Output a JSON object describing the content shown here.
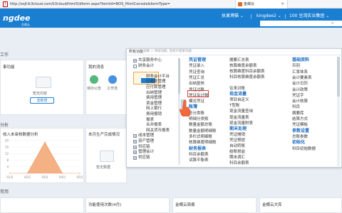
{
  "browser": {
    "url": "http://zsjf.ik3cloud.com/k3cloud/html5/dform.aspx?formId=BOS_HtmlConsole&formType=",
    "tab_title": "金蝶云"
  },
  "header": {
    "logo": "ngdee",
    "logo_sub": "金蝶云",
    "settings": "执果博猫 ⌄",
    "user": "kingdee2 ⌄",
    "org": "100 豆湾实业集团 ⌄"
  },
  "dashboard": {
    "section_work": "工作",
    "section_analysis": "分析",
    "section_common": "常用",
    "todo_title": "事功能",
    "todo_empty": "暂无内容",
    "todo_button": "去新增",
    "msg_title": "我的消息",
    "msg_items": [
      "待办公告",
      "工作流"
    ],
    "chart_title": "收入未审核数据分析",
    "production_title": "本月生产完成情况",
    "production_empty": "暂无数据",
    "usage_title": "功能使用次数(4月)",
    "cloud_title": "金蝶云简报",
    "bank_title": "金蝶云文库"
  },
  "chart_data": {
    "type": "area",
    "categories": [
      "01月",
      "02月",
      "03月",
      "04月",
      "05月"
    ],
    "values": [
      0,
      0,
      19,
      0,
      0
    ],
    "ylim": [
      0,
      20
    ],
    "yticks": [
      "20",
      "16",
      "12",
      "8",
      "4"
    ],
    "colors": {
      "fill": "#f4b183",
      "line": "#f19a5f"
    }
  },
  "menu": {
    "all_label": "所有功能",
    "breadcrumb": "退换 > 持续功能, 无统计结果功能",
    "tree": [
      {
        "label": "共享服务中心",
        "expander": "+"
      },
      {
        "label": "财务会计",
        "expander": "-"
      },
      {
        "label": "总账",
        "expander": ""
      },
      {
        "label": "财务会计平台",
        "expander": ""
      },
      {
        "label": "应收款管理",
        "expander": ""
      },
      {
        "label": "应付款管理",
        "expander": ""
      },
      {
        "label": "出纳管理",
        "expander": ""
      },
      {
        "label": "费用管理",
        "expander": ""
      },
      {
        "label": "资金管理",
        "expander": ""
      },
      {
        "label": "网上银行",
        "expander": ""
      },
      {
        "label": "费用报销",
        "expander": ""
      },
      {
        "label": "报表",
        "expander": ""
      },
      {
        "label": "合并报表",
        "expander": ""
      },
      {
        "label": "网关货币报表",
        "expander": ""
      },
      {
        "label": "成本管理",
        "expander": "+"
      },
      {
        "label": "资产管理",
        "expander": "+"
      },
      {
        "label": "供应链",
        "expander": "+"
      },
      {
        "label": "管理会计",
        "expander": "+"
      },
      {
        "label": "供应链",
        "expander": "+"
      }
    ],
    "col1": [
      {
        "type": "group",
        "label": "凭证管理"
      },
      {
        "type": "fn",
        "label": "凭证录入"
      },
      {
        "type": "fn",
        "label": "凭证查询"
      },
      {
        "type": "fn",
        "label": "凭证汇总"
      },
      {
        "type": "fn",
        "label": "出纳复核"
      },
      {
        "type": "fn",
        "label": "凭证过账"
      },
      {
        "type": "fn",
        "label": "凭证反过账"
      },
      {
        "type": "fn",
        "label": "模式凭证"
      },
      {
        "type": "group",
        "label": "账簿"
      },
      {
        "type": "fn",
        "label": "总分类账"
      },
      {
        "type": "fn",
        "label": "明细分类账"
      },
      {
        "type": "fn",
        "label": "数量金额总账"
      },
      {
        "type": "fn",
        "label": "数量金额明细账"
      },
      {
        "type": "fn",
        "label": "多栏式明细账"
      },
      {
        "type": "fn",
        "label": "核算维度明细账"
      },
      {
        "type": "group",
        "label": "财务报表"
      },
      {
        "type": "fn",
        "label": "科目余额表"
      },
      {
        "type": "fn",
        "label": "试算平衡表"
      }
    ],
    "col2": [
      {
        "type": "fn",
        "label": "摘要汇总表"
      },
      {
        "type": "fn",
        "label": "核算维度余额表"
      },
      {
        "type": "fn",
        "label": "核算维度科目余额表"
      },
      {
        "type": "fn",
        "label": "科目核算维度余额表"
      },
      {
        "type": "fn",
        "label": ""
      },
      {
        "type": "fn",
        "label": "往来对账"
      },
      {
        "type": "group",
        "label": "现金流量"
      },
      {
        "type": "fn",
        "label": "项目自定义"
      },
      {
        "type": "fn",
        "label": "T型账"
      },
      {
        "type": "fn",
        "label": "现金流量查询"
      },
      {
        "type": "fn",
        "label": "现金流量表"
      },
      {
        "type": "fn",
        "label": "现金流量附表"
      },
      {
        "type": "group",
        "label": "期末处理"
      },
      {
        "type": "fn",
        "label": "凭证摊销"
      },
      {
        "type": "fn",
        "label": "凭证预提"
      },
      {
        "type": "fn",
        "label": "自动转账"
      },
      {
        "type": "fn",
        "label": "结账损益"
      },
      {
        "type": "fn",
        "label": "期末调汇"
      },
      {
        "type": "fn",
        "label": "科目余额表"
      }
    ],
    "col3": [
      {
        "type": "group",
        "label": "基础资料"
      },
      {
        "type": "fn",
        "label": "币别"
      },
      {
        "type": "fn",
        "label": "汇率体系"
      },
      {
        "type": "fn",
        "label": "会计要素表"
      },
      {
        "type": "fn",
        "label": "会计日历"
      },
      {
        "type": "fn",
        "label": "会计政策"
      },
      {
        "type": "fn",
        "label": "凭证字"
      },
      {
        "type": "fn",
        "label": "会计核算"
      },
      {
        "type": "fn",
        "label": "科目"
      },
      {
        "type": "fn",
        "label": "摘要库"
      },
      {
        "type": "fn",
        "label": "结算方式"
      },
      {
        "type": "fn",
        "label": "凭证模板"
      },
      {
        "type": "group",
        "label": "参数设置"
      },
      {
        "type": "fn",
        "label": "总账参数"
      },
      {
        "type": "group",
        "label": "初始化"
      },
      {
        "type": "fn",
        "label": "科目初始数据"
      }
    ]
  }
}
